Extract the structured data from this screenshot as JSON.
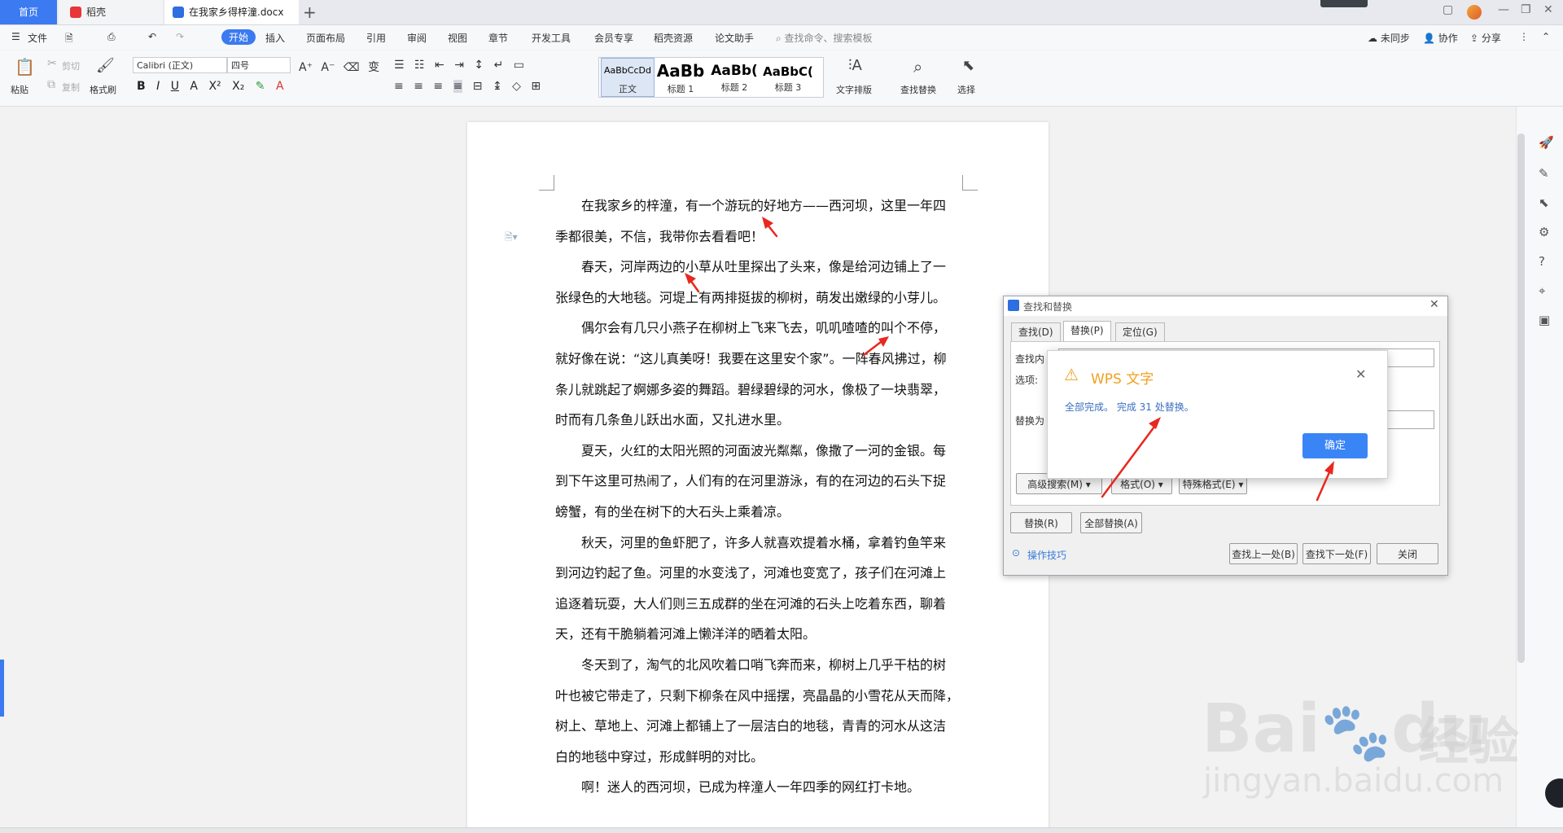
{
  "tabs": {
    "home": "首页",
    "docer": "稻壳",
    "doc": "在我家乡得梓潼.docx",
    "new_tab": "+"
  },
  "menu": {
    "file": "文件",
    "items": [
      "开始",
      "插入",
      "页面布局",
      "引用",
      "审阅",
      "视图",
      "章节",
      "开发工具",
      "会员专享",
      "稻壳资源",
      "论文助手"
    ],
    "search": "查找命令、搜索模板",
    "unsynced": "未同步",
    "collab": "协作",
    "share": "分享"
  },
  "ribbon": {
    "paste": "粘贴",
    "cut": "剪切",
    "copy": "复制",
    "format_painter": "格式刷",
    "font_name": "Calibri (正文)",
    "font_size": "四号",
    "styles": [
      {
        "preview": "AaBbCcDd",
        "name": "正文"
      },
      {
        "preview": "AaBb",
        "name": "标题 1"
      },
      {
        "preview": "AaBb(",
        "name": "标题 2"
      },
      {
        "preview": "AaBbC(",
        "name": "标题 3"
      }
    ],
    "text_layout": "文字排版",
    "find_replace": "查找替换",
    "select": "选择"
  },
  "document": {
    "paragraphs": [
      [
        "　　在我家乡的梓潼，有一个游玩的好地方——西河坝，这里一年四",
        "季都很美，不信，我带你去看看吧！"
      ],
      [
        "　　春天，河岸两边的小草从吐里探出了头来，像是给河边铺上了一",
        "张绿色的大地毯。河堤上有两排挺拔的柳树，萌发出嫩绿的小芽儿。"
      ],
      [
        "　　偶尔会有几只小燕子在柳树上飞来飞去，叽叽喳喳的叫个不停，",
        "就好像在说：“这儿真美呀！我要在这里安个家”。一阵春风拂过，柳",
        "条儿就跳起了婀娜多姿的舞蹈。碧绿碧绿的河水，像极了一块翡翠，",
        "时而有几条鱼儿跃出水面，又扎进水里。"
      ],
      [
        "　　夏天，火红的太阳光照的河面波光粼粼，像撒了一河的金银。每",
        "到下午这里可热闹了，人们有的在河里游泳，有的在河边的石头下捉",
        "螃蟹，有的坐在树下的大石头上乘着凉。"
      ],
      [
        "　　秋天，河里的鱼虾肥了，许多人就喜欢提着水桶，拿着钓鱼竿来",
        "到河边钓起了鱼。河里的水变浅了，河滩也变宽了，孩子们在河滩上",
        "追逐着玩耍，大人们则三五成群的坐在河滩的石头上吃着东西，聊着",
        "天，还有干脆躺着河滩上懒洋洋的晒着太阳。"
      ],
      [
        "　　冬天到了，淘气的北风吹着口哨飞奔而来，柳树上几乎干枯的树",
        "叶也被它带走了，只剩下柳条在风中摇摆，亮晶晶的小雪花从天而降，",
        "树上、草地上、河滩上都铺上了一层洁白的地毯，青青的河水从这洁",
        "白的地毯中穿过，形成鲜明的对比。"
      ],
      [
        "　　啊！迷人的西河坝，已成为梓潼人一年四季的网红打卡地。"
      ]
    ]
  },
  "find_replace": {
    "title": "查找和替换",
    "tabs": [
      "查找(D)",
      "替换(P)",
      "定位(G)"
    ],
    "find_label": "查找内",
    "options_label": "选项:",
    "replace_label": "替换为",
    "advanced": "高级搜索(M)",
    "format": "格式(O)",
    "special": "特殊格式(E)",
    "replace_btn": "替换(R)",
    "replace_all_btn": "全部替换(A)",
    "tips": "操作技巧",
    "find_prev": "查找上一处(B)",
    "find_next": "查找下一处(F)",
    "close": "关闭"
  },
  "message_box": {
    "title": "WPS 文字",
    "message": "全部完成。 完成 31 处替换。",
    "ok": "确定"
  },
  "watermark": {
    "logo": "Bai",
    "logo2": "du",
    "cn": "经验",
    "url": "jingyan.baidu.com"
  },
  "colors": {
    "accent": "#3b7af0",
    "arrow": "#e8281e",
    "ok_button": "#3a85f6"
  }
}
